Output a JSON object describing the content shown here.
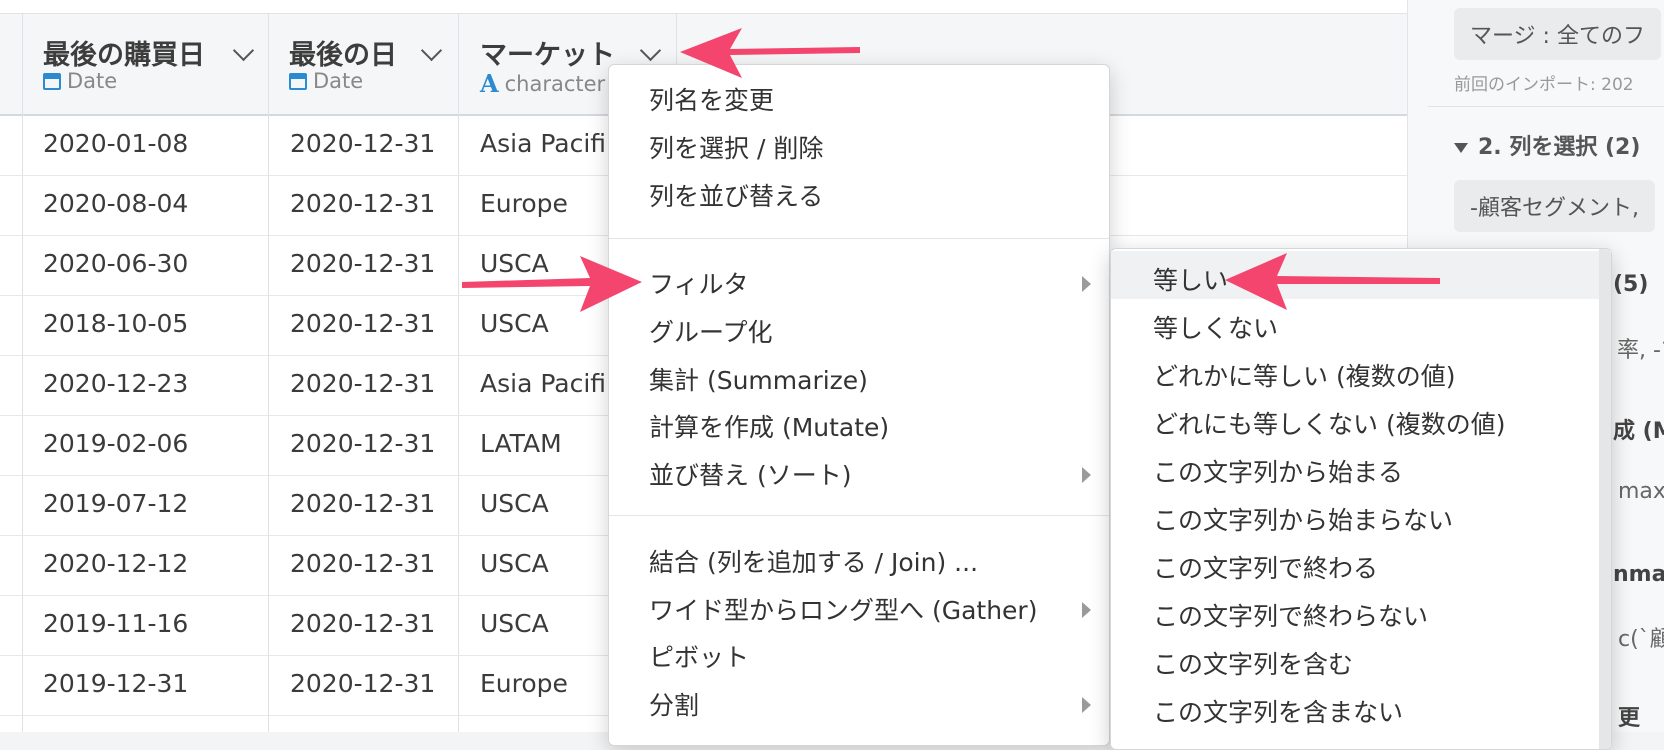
{
  "colors": {
    "accent": "#2a8bd0",
    "annotation_arrow": "#f3456e"
  },
  "columns": [
    {
      "name": "最後の購買日",
      "type": "Date",
      "type_icon": "calendar-icon"
    },
    {
      "name": "最後の日",
      "type": "Date",
      "type_icon": "calendar-icon"
    },
    {
      "name": "マーケット",
      "type": "character",
      "type_icon": "character-type-icon",
      "type_glyph": "A"
    }
  ],
  "rows": [
    [
      "2020-01-08",
      "2020-12-31",
      "Asia Pacifi"
    ],
    [
      "2020-08-04",
      "2020-12-31",
      "Europe"
    ],
    [
      "2020-06-30",
      "2020-12-31",
      "USCA"
    ],
    [
      "2018-10-05",
      "2020-12-31",
      "USCA"
    ],
    [
      "2020-12-23",
      "2020-12-31",
      "Asia Pacifi"
    ],
    [
      "2019-02-06",
      "2020-12-31",
      "LATAM"
    ],
    [
      "2019-07-12",
      "2020-12-31",
      "USCA"
    ],
    [
      "2020-12-12",
      "2020-12-31",
      "USCA"
    ],
    [
      "2019-11-16",
      "2020-12-31",
      "USCA"
    ],
    [
      "2019-12-31",
      "2020-12-31",
      "Europe"
    ]
  ],
  "context_menu": {
    "group1": [
      "列名を変更",
      "列を選択 / 削除",
      "列を並び替える"
    ],
    "group2": [
      {
        "label": "フィルタ",
        "submenu": true
      },
      {
        "label": "グループ化",
        "submenu": false
      },
      {
        "label": "集計 (Summarize)",
        "submenu": false
      },
      {
        "label": "計算を作成 (Mutate)",
        "submenu": false
      },
      {
        "label": "並び替え (ソート)",
        "submenu": true
      }
    ],
    "group3": [
      {
        "label": "結合 (列を追加する / Join) ...",
        "submenu": false
      },
      {
        "label": "ワイド型からロング型へ (Gather)",
        "submenu": true
      },
      {
        "label": "ピボット",
        "submenu": false
      },
      {
        "label": "分割",
        "submenu": true
      }
    ]
  },
  "filter_submenu": [
    "等しい",
    "等しくない",
    "どれかに等しい (複数の値)",
    "どれにも等しくない (複数の値)",
    "この文字列から始まる",
    "この文字列から始まらない",
    "この文字列で終わる",
    "この文字列で終わらない",
    "この文字列を含む",
    "この文字列を含まない"
  ],
  "right_panel": {
    "merge_chip": "マージ : 全てのフ",
    "last_import": "前回のインポート: 202",
    "step2_title": "2. 列を選択 (2)",
    "step2_chip": "-顧客セグメント,",
    "frag_count": "(5)",
    "frag_rate": "率, -マ",
    "frag_mutate": "成 (M",
    "frag_max": "max(",
    "frag_summarize": "nmar",
    "frag_c": "c(`顧",
    "frag_change": "更"
  }
}
